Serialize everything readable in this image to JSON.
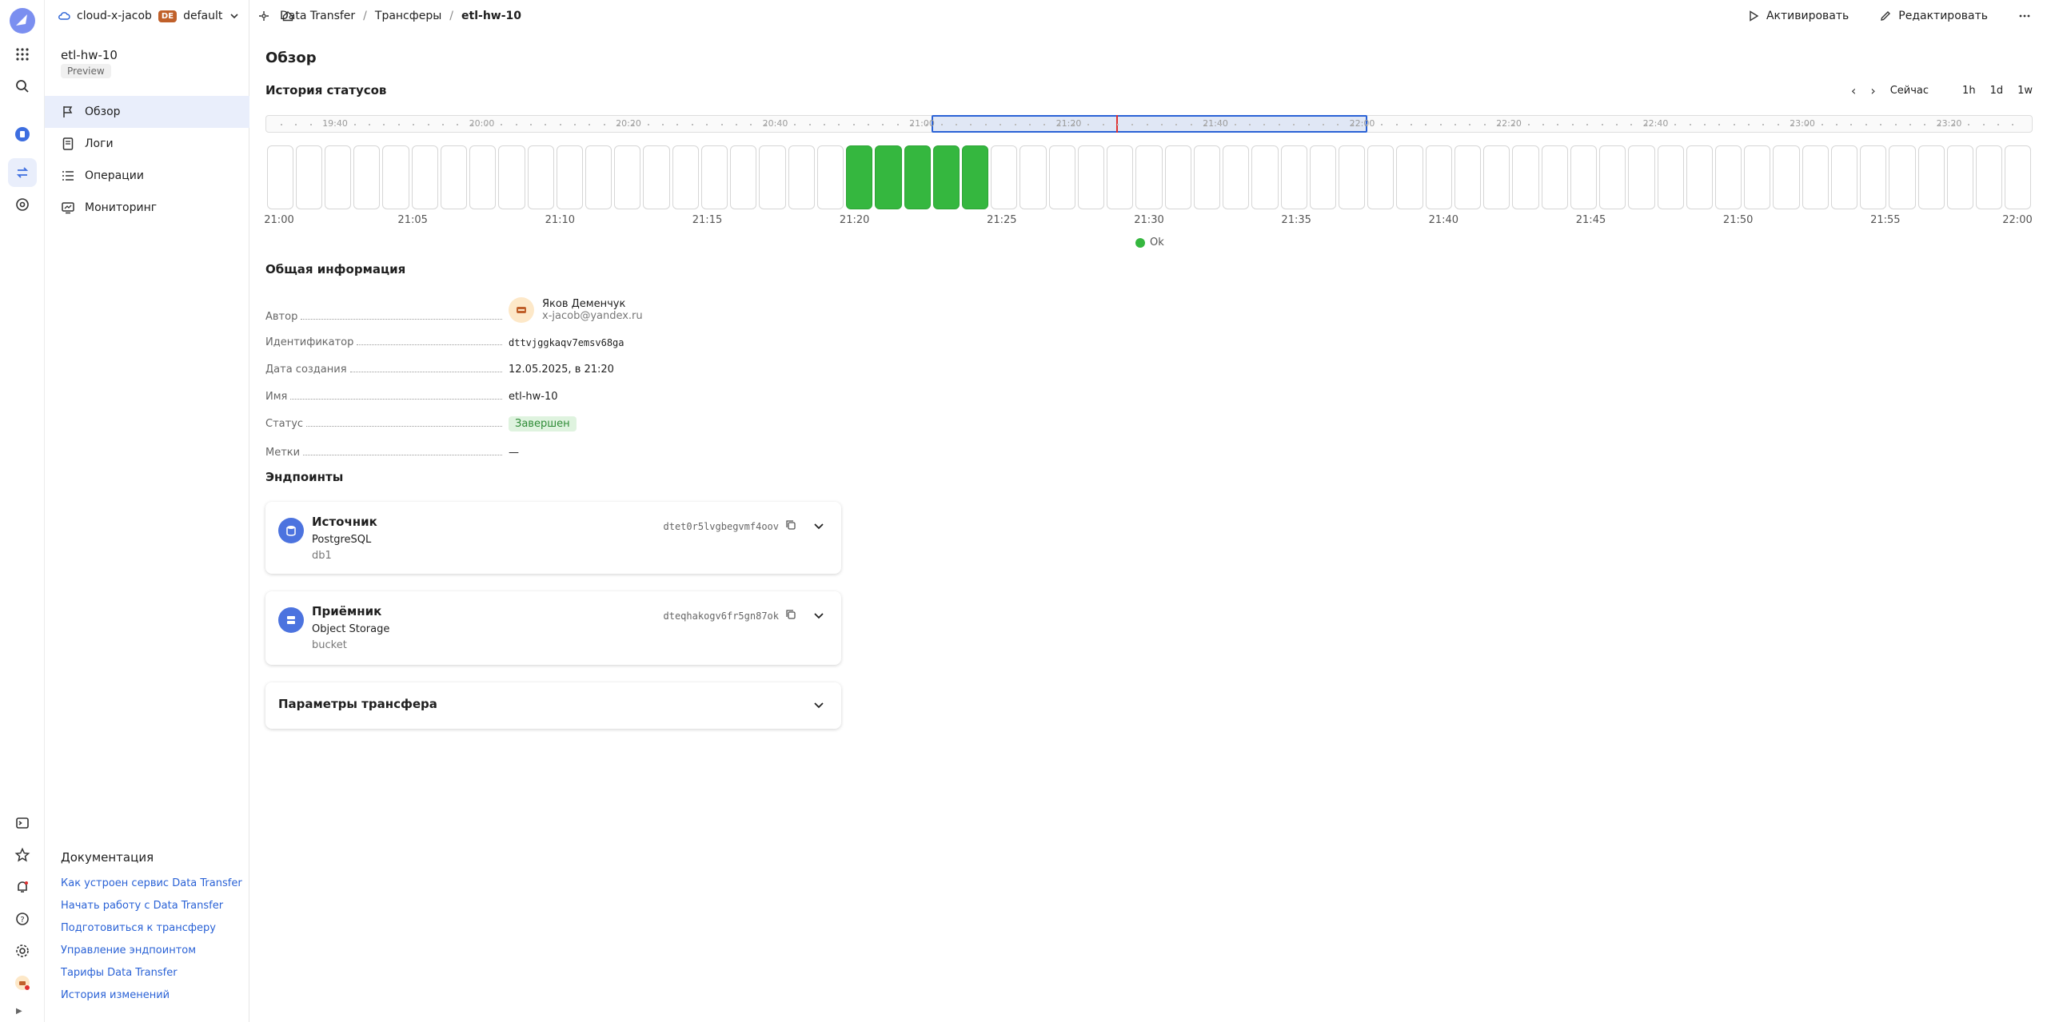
{
  "topbar": {
    "cloud": "cloud-x-jacob",
    "folder_badge": "DE",
    "folder": "default",
    "breadcrumbs": [
      "Data Transfer",
      "Трансферы",
      "etl-hw-10"
    ],
    "activate_label": "Активировать",
    "edit_label": "Редактировать"
  },
  "sidebar": {
    "title": "etl-hw-10",
    "badge": "Preview",
    "items": [
      {
        "label": "Обзор",
        "icon": "flag-icon"
      },
      {
        "label": "Логи",
        "icon": "document-icon"
      },
      {
        "label": "Операции",
        "icon": "list-icon"
      },
      {
        "label": "Мониторинг",
        "icon": "monitor-icon"
      }
    ],
    "docs_title": "Документация",
    "docs": [
      "Как устроен сервис Data Transfer",
      "Начать работу с Data Transfer",
      "Подготовиться к трансферу",
      "Управление эндпоинтом",
      "Тарифы Data Transfer",
      "История изменений"
    ]
  },
  "main": {
    "page_title": "Обзор",
    "history_title": "История статусов",
    "now_label": "Сейчас",
    "ranges": [
      "1h",
      "1d",
      "1w"
    ],
    "overview_ticks": [
      "19:40",
      "20:00",
      "20:20",
      "20:40",
      "21:00",
      "21:20",
      "21:40",
      "22:00",
      "22:20",
      "22:40",
      "23:00",
      "23:20"
    ],
    "axis_ticks": [
      "21:00",
      "21:05",
      "21:10",
      "21:15",
      "21:20",
      "21:25",
      "21:30",
      "21:35",
      "21:40",
      "21:45",
      "21:50",
      "21:55",
      "22:00"
    ],
    "legend_ok": "Ok",
    "general_title": "Общая информация",
    "author_key": "Автор",
    "author_name": "Яков Деменчук",
    "author_email": "x-jacob@yandex.ru",
    "id_key": "Идентификатор",
    "id_value": "dttvjggkaqv7emsv68ga",
    "created_key": "Дата создания",
    "created_value": "12.05.2025, в 21:20",
    "name_key": "Имя",
    "name_value": "etl-hw-10",
    "status_key": "Статус",
    "status_value": "Завершен",
    "labels_key": "Метки",
    "labels_value": "—",
    "endpoints_title": "Эндпоинты",
    "source": {
      "title": "Источник",
      "type": "PostgreSQL",
      "sub": "db1",
      "id": "dtet0r5lvgbegvmf4oov"
    },
    "target": {
      "title": "Приёмник",
      "type": "Object Storage",
      "sub": "bucket",
      "id": "dteqhakogv6fr5gn87ok"
    },
    "params_title": "Параметры трансфера"
  },
  "timeline": {
    "slot_count": 61,
    "ok_slots": [
      20,
      21,
      22,
      23,
      24
    ],
    "colors": {
      "ok": "#35b73f",
      "accent": "#2a62d6",
      "now": "#e03030"
    }
  }
}
